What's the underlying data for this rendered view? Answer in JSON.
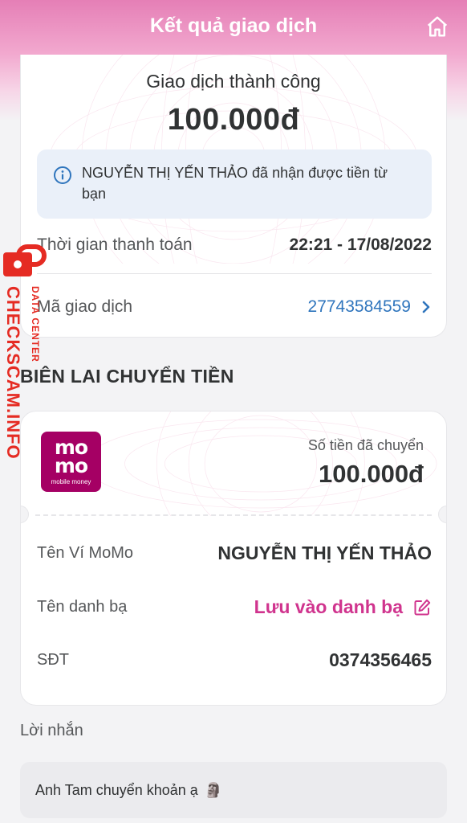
{
  "header": {
    "title": "Kết quả giao dịch",
    "home_icon": "home-icon"
  },
  "result": {
    "status": "Giao dịch thành công",
    "amount": "100.000đ",
    "info_text": "NGUYỄN THỊ YẾN THẢO đã nhận được tiền từ bạn",
    "payment_time_label": "Thời gian thanh toán",
    "payment_time_value": "22:21 - 17/08/2022",
    "txn_id_label": "Mã giao dịch",
    "txn_id_value": "27743584559"
  },
  "receipt": {
    "title": "BIÊN LAI CHUYỂN TIỀN",
    "logo_top": "mo",
    "logo_bottom": "mo",
    "logo_sub": "mobile money",
    "sent_label": "Số tiền đã chuyển",
    "sent_amount": "100.000đ",
    "wallet_label": "Tên Ví MoMo",
    "wallet_value": "NGUYỄN THỊ YẾN THẢO",
    "contact_label": "Tên danh bạ",
    "contact_action": "Lưu vào danh bạ",
    "phone_label": "SĐT",
    "phone_value": "0374356465"
  },
  "message": {
    "label": "Lời nhắn",
    "text": "Anh Tam chuyển khoản ạ",
    "emoji": "🗿"
  },
  "watermark": {
    "main": "CHECKSCAM.INFO",
    "sub": "DATA CENTER"
  },
  "colors": {
    "brand": "#a50064",
    "link": "#2f75bd",
    "accent_pink": "#d0348e",
    "watermark_red": "#e52b23"
  }
}
